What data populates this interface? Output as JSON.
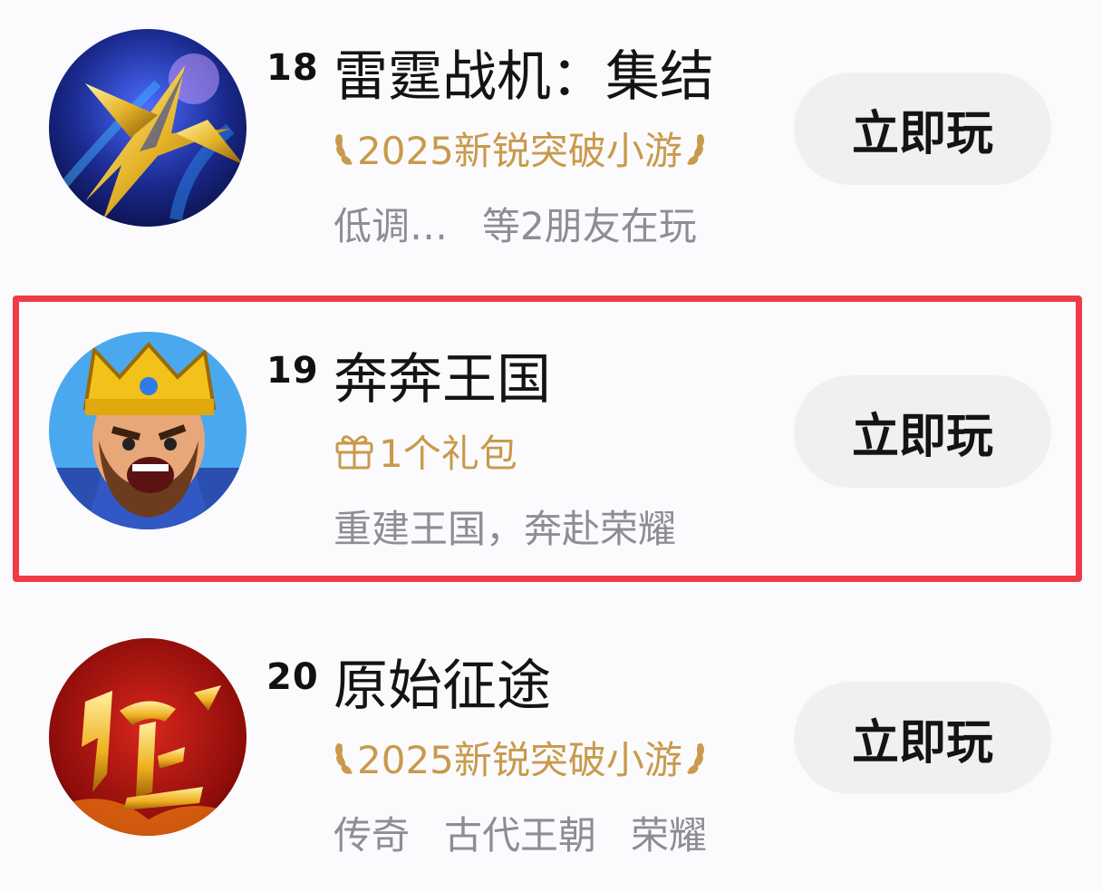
{
  "games": [
    {
      "rank": "18",
      "name": "雷霆战机：集结",
      "tag": {
        "type": "award",
        "text": "2025新锐突破小游"
      },
      "desc": [
        "低调…",
        "等2朋友在玩"
      ],
      "button_label": "立即玩",
      "icon": "jet-fighter-icon"
    },
    {
      "rank": "19",
      "name": "奔奔王国",
      "tag": {
        "type": "gift",
        "text": "1个礼包"
      },
      "desc": [
        "重建王国，奔赴荣耀"
      ],
      "button_label": "立即玩",
      "icon": "king-avatar-icon"
    },
    {
      "rank": "20",
      "name": "原始征途",
      "tag": {
        "type": "award",
        "text": "2025新锐突破小游"
      },
      "desc": [
        "传奇",
        "古代王朝",
        "荣耀"
      ],
      "button_label": "立即玩",
      "icon": "zheng-calligraphy-icon"
    }
  ],
  "colors": {
    "highlight_border": "#ee3b45",
    "tag_gold": "#c99a4c",
    "button_bg": "#f0f0f3",
    "desc_gray": "#8d8d96"
  }
}
